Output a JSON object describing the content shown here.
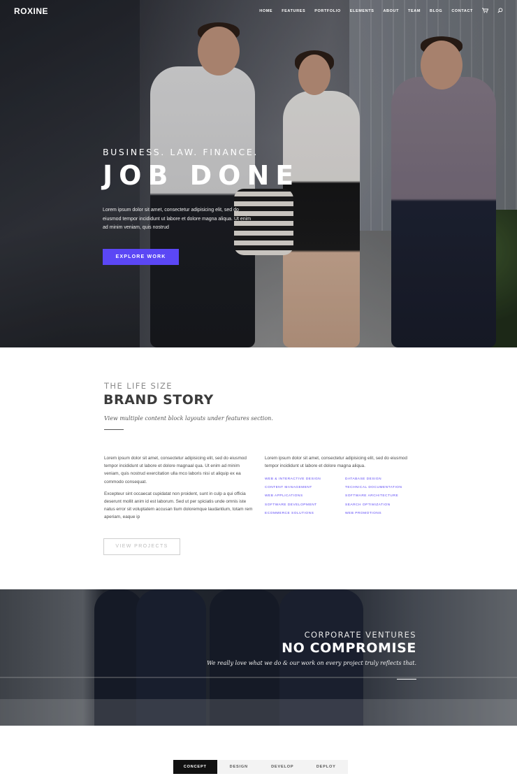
{
  "nav": {
    "logo": "ROXINE",
    "items": [
      "HOME",
      "FEATURES",
      "PORTFOLIO",
      "ELEMENTS",
      "ABOUT",
      "TEAM",
      "BLOG",
      "CONTACT"
    ],
    "icons": [
      "cart-icon",
      "search-icon"
    ]
  },
  "hero": {
    "kicker": "BUSINESS. LAW. FINANCE.",
    "title": "JOB DONE",
    "body": "Lorem ipsum dolor sit amet, consectetur adipisicing elit, sed do eiusmod tempor incididunt ut labore et dolore magna aliqua. Ut enim ad minim veniam, quis nostrud",
    "button": "EXPLORE WORK",
    "button_color": "#5b47f5"
  },
  "story": {
    "kicker": "THE LIFE SIZE",
    "title": "BRAND STORY",
    "subtitle": "View multiple content block layouts under features section.",
    "left_p1": "Lorem ipsum dolor sit amet, consectetur adipisicing elit, sed do eiusmod tempor incididunt ut labore et dolore magnaal qua. Ut enim ad minim veniam, quis nostrud exercitation ulla mco laboris nisi ut aliquip ex ea commodo consequat.",
    "left_p2": "Excepteur sint occaecat cupidatat non proident, sunt in culp a qui officia deserunt mollit anim id est laborum. Sed ut per spiciatis unde omnis iste natus error sit voluptatem accusan tium doloremque laudantium, totam rem aperiam, eaque ip",
    "right_p": "Lorem ipsum dolor sit amet, consectetur adipisicing elit, sed do eiusmod tempor incididunt ut labore et dolore magna aliqua.",
    "services": [
      "WEB & INTERACTIVE DESIGN",
      "DATABASE DESIGN",
      "CONTENT MANAGEMENT",
      "TECHNICAL DOCUMENTATION",
      "WEB APPLICATIONS",
      "SOFTWARE ARCHITECTURE",
      "SOFTWARE DEVELOPMENT",
      "SEARCH OPTIMIZATION",
      "ECOMMERCE SOLUTIONS",
      "WEB PROMOTIONS"
    ],
    "button": "VIEW PROJECTS"
  },
  "banner": {
    "kicker": "CORPORATE VENTURES",
    "title": "NO COMPROMISE",
    "subtitle": "We really love what we do & our work on every project truly reflects that."
  },
  "tabs": [
    "CONCEPT",
    "DESIGN",
    "DEVELOP",
    "DEPLOY"
  ]
}
